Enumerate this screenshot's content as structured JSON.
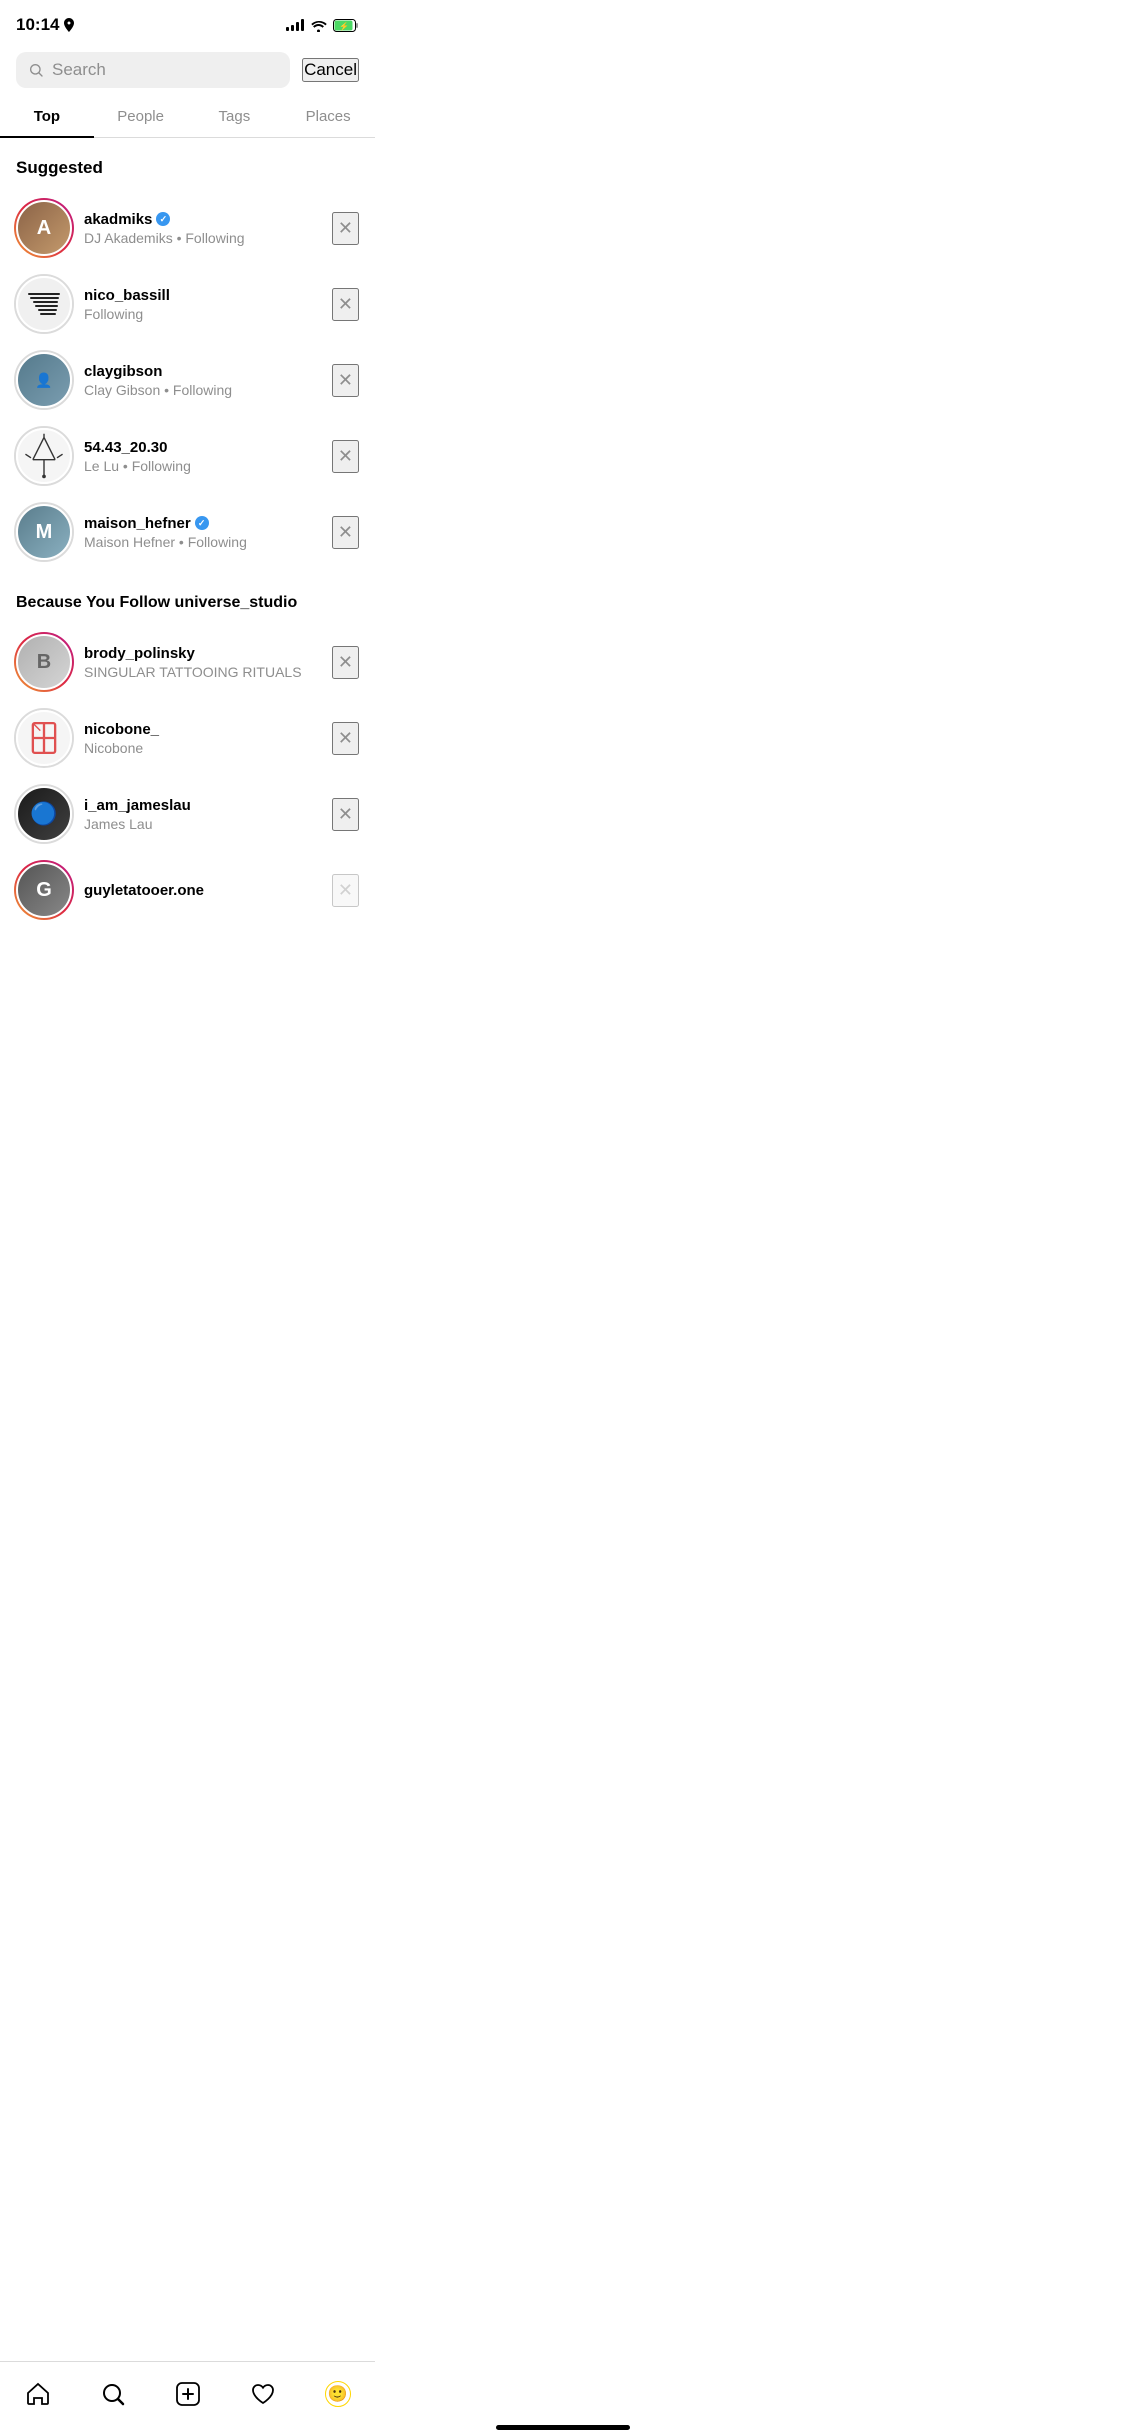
{
  "statusBar": {
    "time": "10:14",
    "hasLocation": true
  },
  "searchBar": {
    "placeholder": "Search",
    "cancelLabel": "Cancel"
  },
  "tabs": [
    {
      "id": "top",
      "label": "Top",
      "active": true
    },
    {
      "id": "people",
      "label": "People",
      "active": false
    },
    {
      "id": "tags",
      "label": "Tags",
      "active": false
    },
    {
      "id": "places",
      "label": "Places",
      "active": false
    }
  ],
  "sections": [
    {
      "title": "Suggested",
      "users": [
        {
          "username": "akadmiks",
          "subtext": "DJ Akademiks • Following",
          "verified": true,
          "hasStory": true,
          "avatarStyle": "akadmiks"
        },
        {
          "username": "nico_bassill",
          "subtext": "Following",
          "verified": false,
          "hasStory": false,
          "avatarStyle": "nico",
          "specialIcon": "stripes"
        },
        {
          "username": "claygibson",
          "subtext": "Clay Gibson • Following",
          "verified": false,
          "hasStory": false,
          "avatarStyle": "clay"
        },
        {
          "username": "54.43_20.30",
          "subtext": "Le Lu • Following",
          "verified": false,
          "hasStory": false,
          "avatarStyle": "5443",
          "specialIcon": "crosshair"
        },
        {
          "username": "maison_hefner",
          "subtext": "Maison Hefner • Following",
          "verified": true,
          "hasStory": false,
          "avatarStyle": "maison"
        }
      ]
    },
    {
      "title": "Because You Follow universe_studio",
      "users": [
        {
          "username": "brody_polinsky",
          "subtext": "SINGULAR TATTOOING RITUALS",
          "verified": false,
          "hasStory": true,
          "avatarStyle": "brody"
        },
        {
          "username": "nicobone_",
          "subtext": "Nicobone",
          "verified": false,
          "hasStory": false,
          "avatarStyle": "nicobone",
          "specialIcon": "nicobone"
        },
        {
          "username": "i_am_jameslau",
          "subtext": "James Lau",
          "verified": false,
          "hasStory": false,
          "avatarStyle": "james"
        },
        {
          "username": "guyletatooer.one",
          "subtext": "",
          "verified": false,
          "hasStory": true,
          "avatarStyle": "guy",
          "partial": true
        }
      ]
    }
  ],
  "navBar": {
    "items": [
      {
        "id": "home",
        "icon": "home"
      },
      {
        "id": "search",
        "icon": "search",
        "active": true
      },
      {
        "id": "add",
        "icon": "add"
      },
      {
        "id": "heart",
        "icon": "heart"
      },
      {
        "id": "profile",
        "icon": "profile"
      }
    ]
  }
}
